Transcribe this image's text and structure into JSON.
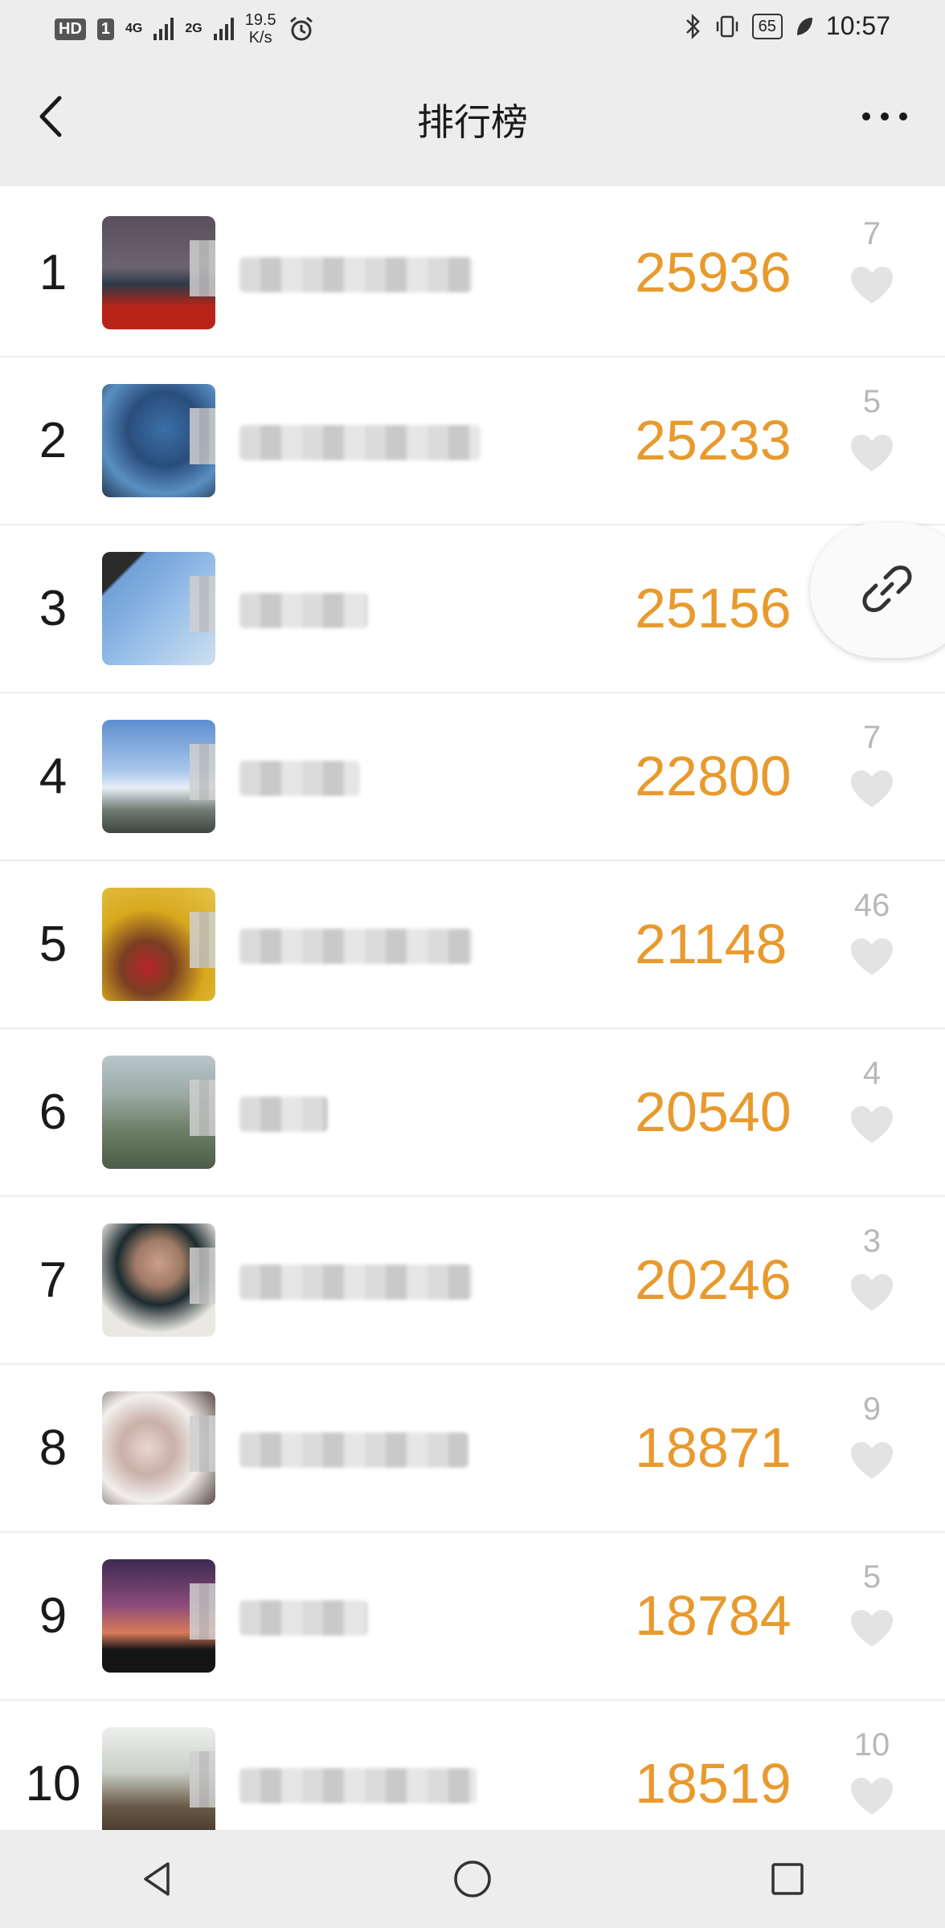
{
  "status_bar": {
    "hd_badge": "HD",
    "sim_badge": "1",
    "net1": "4G",
    "net2": "2G",
    "speed_value": "19.5",
    "speed_unit": "K/s",
    "battery": "65",
    "time": "10:57"
  },
  "header": {
    "title": "排行榜"
  },
  "ranking": [
    {
      "rank": "1",
      "score": "25936",
      "likes": "7",
      "name_width_hint": "wide"
    },
    {
      "rank": "2",
      "score": "25233",
      "likes": "5",
      "name_width_hint": "wide"
    },
    {
      "rank": "3",
      "score": "25156",
      "likes": "",
      "name_width_hint": "short"
    },
    {
      "rank": "4",
      "score": "22800",
      "likes": "7",
      "name_width_hint": "short"
    },
    {
      "rank": "5",
      "score": "21148",
      "likes": "46",
      "name_width_hint": "wide"
    },
    {
      "rank": "6",
      "score": "20540",
      "likes": "4",
      "name_width_hint": "tiny"
    },
    {
      "rank": "7",
      "score": "20246",
      "likes": "3",
      "name_width_hint": "wide"
    },
    {
      "rank": "8",
      "score": "18871",
      "likes": "9",
      "name_width_hint": "wide"
    },
    {
      "rank": "9",
      "score": "18784",
      "likes": "5",
      "name_width_hint": "short"
    },
    {
      "rank": "10",
      "score": "18519",
      "likes": "10",
      "name_width_hint": "wide"
    }
  ],
  "colors": {
    "score": "#e89a2e",
    "likes": "#b8b8b8",
    "background": "#ededed"
  },
  "icons": {
    "back": "chevron-left-icon",
    "more": "more-dots-icon",
    "heart": "heart-icon",
    "link": "link-icon",
    "sys_back": "triangle-back-icon",
    "sys_home": "circle-home-icon",
    "sys_recent": "square-recent-icon"
  }
}
